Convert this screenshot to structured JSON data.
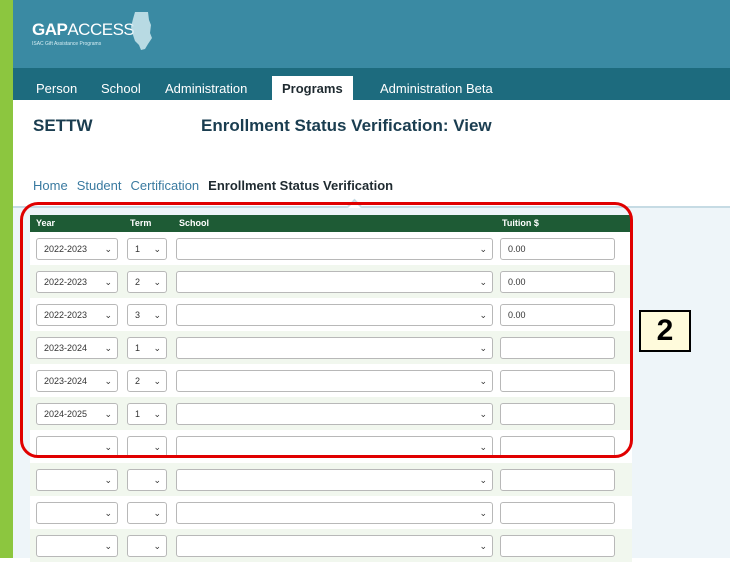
{
  "logo": {
    "brand_bold": "GAP",
    "brand_light": "ACCESS",
    "tagline": "ISAC Gift Assistance Programs"
  },
  "nav": {
    "tabs": [
      {
        "label": "Person",
        "active": false
      },
      {
        "label": "School",
        "active": false
      },
      {
        "label": "Administration",
        "active": false
      },
      {
        "label": "Programs",
        "active": true
      },
      {
        "label": "Administration Beta",
        "active": false
      }
    ]
  },
  "header": {
    "program": "SETTW",
    "title": "Enrollment Status Verification: View"
  },
  "breadcrumb": [
    "Home",
    "Student",
    "Certification",
    "Enrollment Status Verification"
  ],
  "table": {
    "columns": [
      "Year",
      "Term",
      "School",
      "Tuition $"
    ],
    "rows": [
      {
        "year": "2022-2023",
        "term": "1",
        "school": "",
        "tuition": "0.00"
      },
      {
        "year": "2022-2023",
        "term": "2",
        "school": "",
        "tuition": "0.00"
      },
      {
        "year": "2022-2023",
        "term": "3",
        "school": "",
        "tuition": "0.00"
      },
      {
        "year": "2023-2024",
        "term": "1",
        "school": "",
        "tuition": ""
      },
      {
        "year": "2023-2024",
        "term": "2",
        "school": "",
        "tuition": ""
      },
      {
        "year": "2024-2025",
        "term": "1",
        "school": "",
        "tuition": ""
      },
      {
        "year": "",
        "term": "",
        "school": "",
        "tuition": ""
      },
      {
        "year": "",
        "term": "",
        "school": "",
        "tuition": ""
      },
      {
        "year": "",
        "term": "",
        "school": "",
        "tuition": ""
      },
      {
        "year": "",
        "term": "",
        "school": "",
        "tuition": ""
      }
    ]
  },
  "annotation": {
    "callout": "2"
  },
  "colors": {
    "header": "#3a8aa3",
    "nav": "#1d6b7e",
    "table_header": "#1e5b35",
    "annotation": "#e00000",
    "accent_bar": "#8cc63f"
  }
}
